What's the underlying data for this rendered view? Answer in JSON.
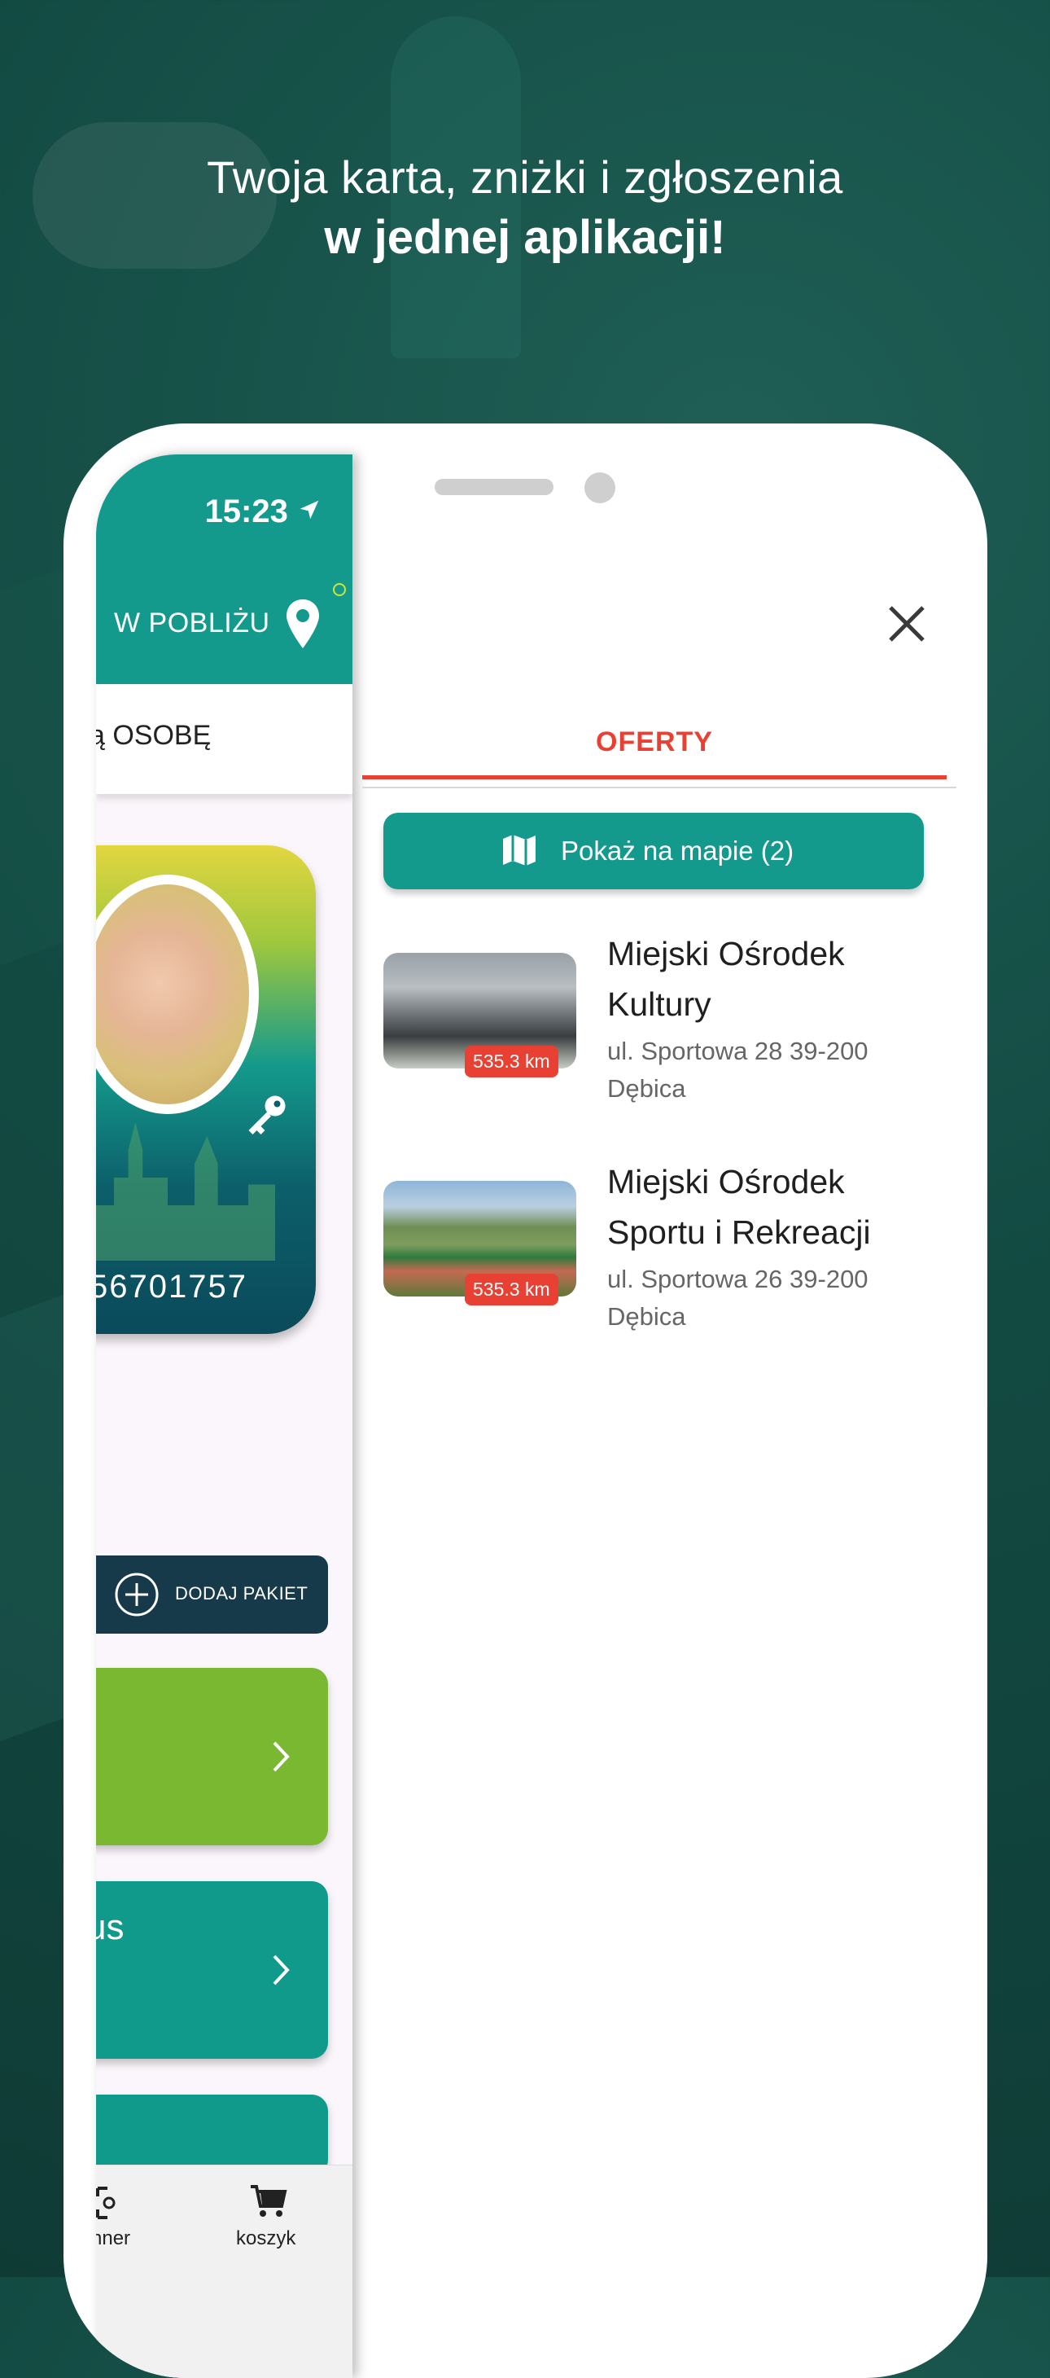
{
  "headline": {
    "line1": "Twoja karta, zniżki i zgłoszenia",
    "line2": "w jednej aplikacji!"
  },
  "drawer": {
    "status_time": "15:23",
    "nearby_label": "W POBLIŻU",
    "person_label": "ą OSOBĘ",
    "card_number": "56701757",
    "add_package_label": "DODAJ PAKIET",
    "tile_teal_text": "us",
    "bottom_nav": {
      "scanner_label": "nner",
      "cart_label": "koszyk"
    }
  },
  "offers_panel": {
    "tab_label": "OFERTY",
    "map_button_label": "Pokaż na mapie (2)",
    "offers": [
      {
        "name": "Miejski Ośrodek Kultury",
        "address_line1": "ul. Sportowa 28 39-200",
        "address_line2": "Dębica",
        "distance": "535.3 km"
      },
      {
        "name": "Miejski Ośrodek Sportu i Rekreacji",
        "address_line1": "ul. Sportowa 26 39-200",
        "address_line2": "Dębica",
        "distance": "535.3 km"
      }
    ]
  },
  "colors": {
    "accent_teal": "#149a8c",
    "accent_red": "#e94034",
    "accent_green": "#7bb832",
    "dark_navy": "#173a4a"
  }
}
